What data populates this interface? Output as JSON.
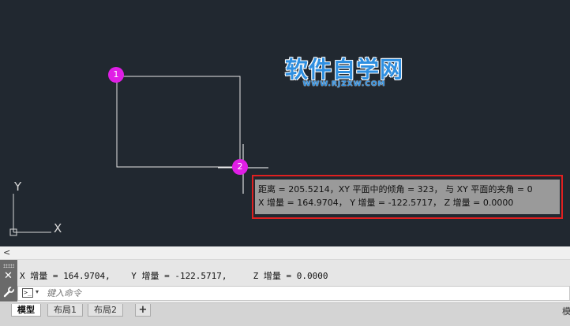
{
  "canvas": {
    "point_markers": [
      "1",
      "2"
    ],
    "axis_labels": {
      "x": "X",
      "y": "Y"
    },
    "watermark": {
      "main": "软件自学网",
      "sub": "WWW.RJZXW.COM"
    },
    "tooltip": {
      "line1": "距离 = 205.5214，XY 平面中的倾角 = 323，  与 XY 平面的夹角 = 0",
      "line2": "X 增量 = 164.9704，  Y 增量 = -122.5717，   Z 增量 = 0.0000"
    },
    "colors": {
      "background": "#212830",
      "geometry": "#e6e6e6",
      "marker": "#e01ee6",
      "highlight": "#e02020",
      "watermark": "#2f8fe0"
    }
  },
  "command_line": {
    "history_toggle": "<",
    "last_output": "X 增量 = 164.9704,    Y 增量 = -122.5717,     Z 增量 = 0.0000",
    "input_placeholder": "键入命令",
    "prompt_symbol": ">_",
    "prompt_dropdown": "▾"
  },
  "tabs": {
    "model": "模型",
    "layout1": "布局1",
    "layout2": "布局2",
    "add": "+",
    "right_label": "模"
  },
  "icons": {
    "close": "close-icon",
    "customize": "wrench-icon",
    "prompt": "command-prompt-icon"
  }
}
